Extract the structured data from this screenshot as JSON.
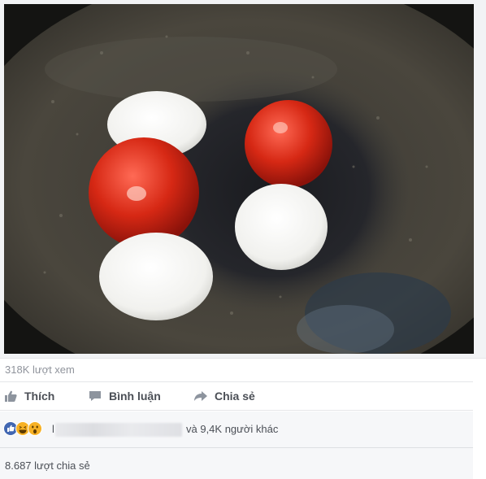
{
  "video": {
    "description_icon": "video-thumbnail"
  },
  "stats": {
    "views": "318K lượt xem"
  },
  "actions": {
    "like_label": "Thích",
    "comment_label": "Bình luận",
    "share_label": "Chia sẻ"
  },
  "reactions": {
    "icons": [
      "like-icon",
      "haha-icon",
      "wow-icon"
    ],
    "prefix": "l",
    "others_text": "và 9,4K người khác"
  },
  "shares": {
    "count_text": "8.687 lượt chia sẻ"
  },
  "colors": {
    "like_blue": "#4267b2",
    "reaction_yellow": "#f7b125",
    "text_gray": "#90949c",
    "action_gray": "#4b4f56"
  }
}
